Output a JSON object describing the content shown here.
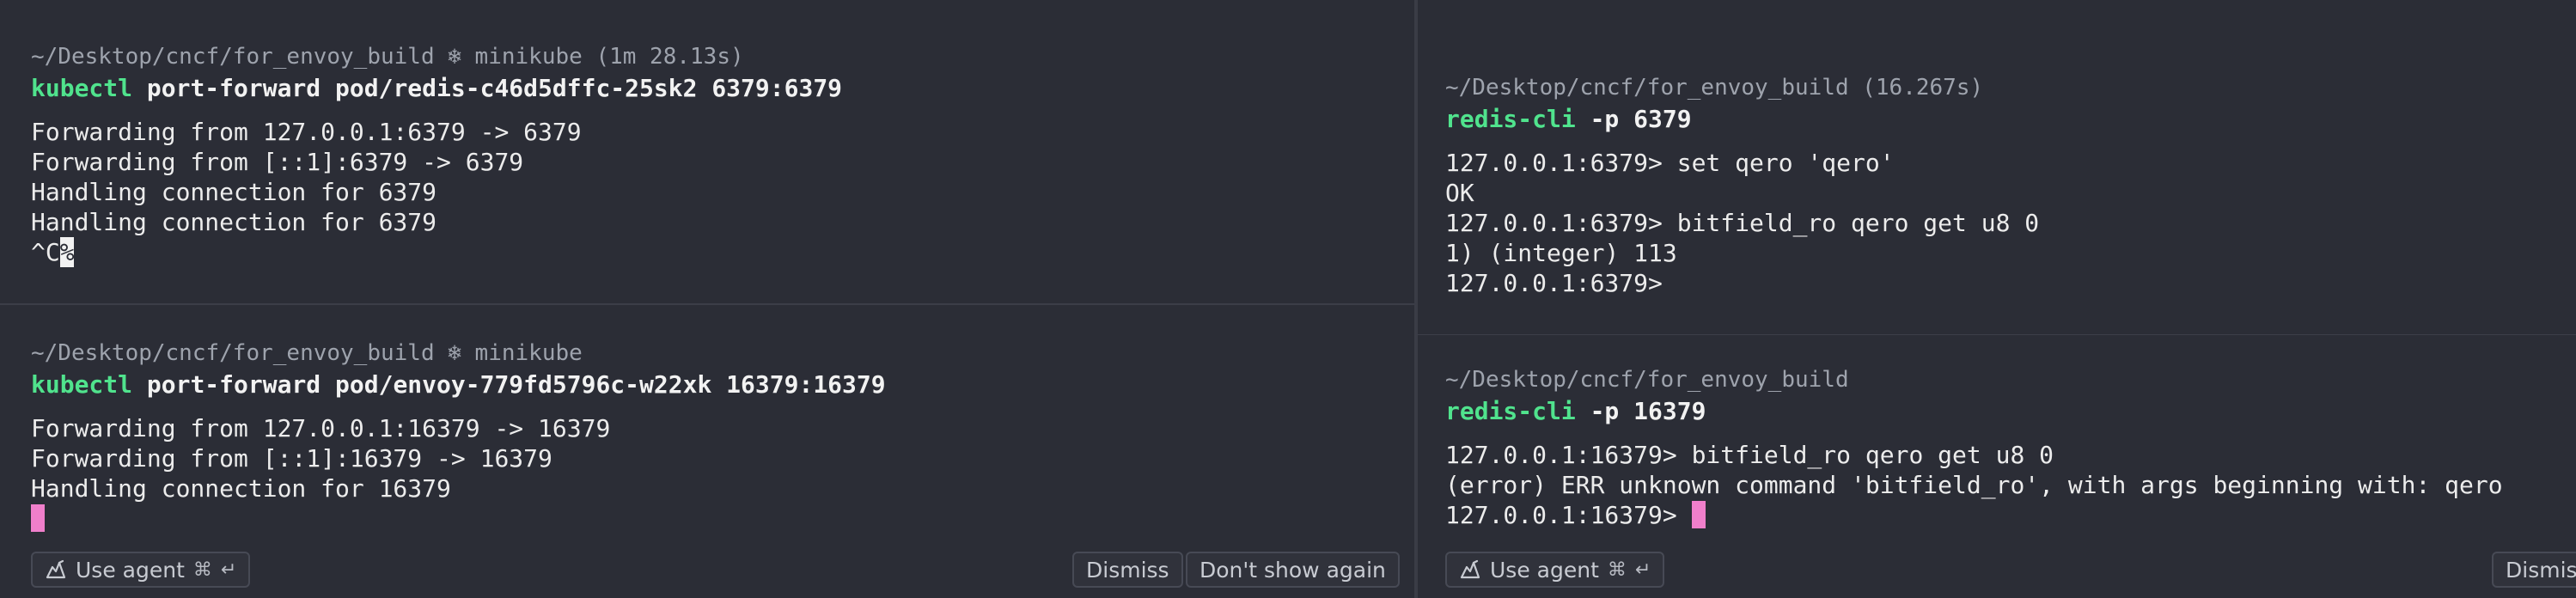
{
  "panes": {
    "top_left": {
      "prompt": "~/Desktop/cncf/for_envoy_build ❄ minikube (1m 28.13s)",
      "command_bin": "kubectl",
      "command_args": " port-forward pod/redis-c46d5dffc-25sk2 6379:6379",
      "output": [
        "Forwarding from 127.0.0.1:6379 -> 6379",
        "Forwarding from [::1]:6379 -> 6379",
        "Handling connection for 6379",
        "Handling connection for 6379"
      ],
      "last_text": "^C",
      "cursor_char": "%"
    },
    "bottom_left": {
      "prompt": "~/Desktop/cncf/for_envoy_build ❄ minikube",
      "command_bin": "kubectl",
      "command_args": " port-forward pod/envoy-779fd5796c-w22xk 16379:16379",
      "output": [
        "Forwarding from 127.0.0.1:16379 -> 16379",
        "Forwarding from [::1]:16379 -> 16379",
        "Handling connection for 16379"
      ]
    },
    "top_right": {
      "prompt": "~/Desktop/cncf/for_envoy_build (16.267s)",
      "command_bin": "redis-cli",
      "command_args": " -p 6379",
      "output": [
        "127.0.0.1:6379> set qero 'qero'",
        "OK",
        "127.0.0.1:6379> bitfield_ro qero get u8 0",
        "1) (integer) 113",
        "127.0.0.1:6379>"
      ]
    },
    "bottom_right": {
      "prompt": "~/Desktop/cncf/for_envoy_build",
      "command_bin": "redis-cli",
      "command_args": " -p 16379",
      "output": [
        "127.0.0.1:16379> bitfield_ro qero get u8 0",
        "(error) ERR unknown command 'bitfield_ro', with args beginning with: qero"
      ],
      "input_prompt": "127.0.0.1:16379> "
    }
  },
  "banner": {
    "use_agent_label": "Use agent",
    "shortcut_cmd": "⌘",
    "shortcut_enter": "↵",
    "dismiss_label": "Dismiss",
    "dont_show_label": "Don't show again"
  },
  "colors": {
    "background": "#2b2d36",
    "command_green": "#50e38d",
    "cursor_pink": "#f07fcb",
    "prompt_gray": "#9ea3ad"
  }
}
